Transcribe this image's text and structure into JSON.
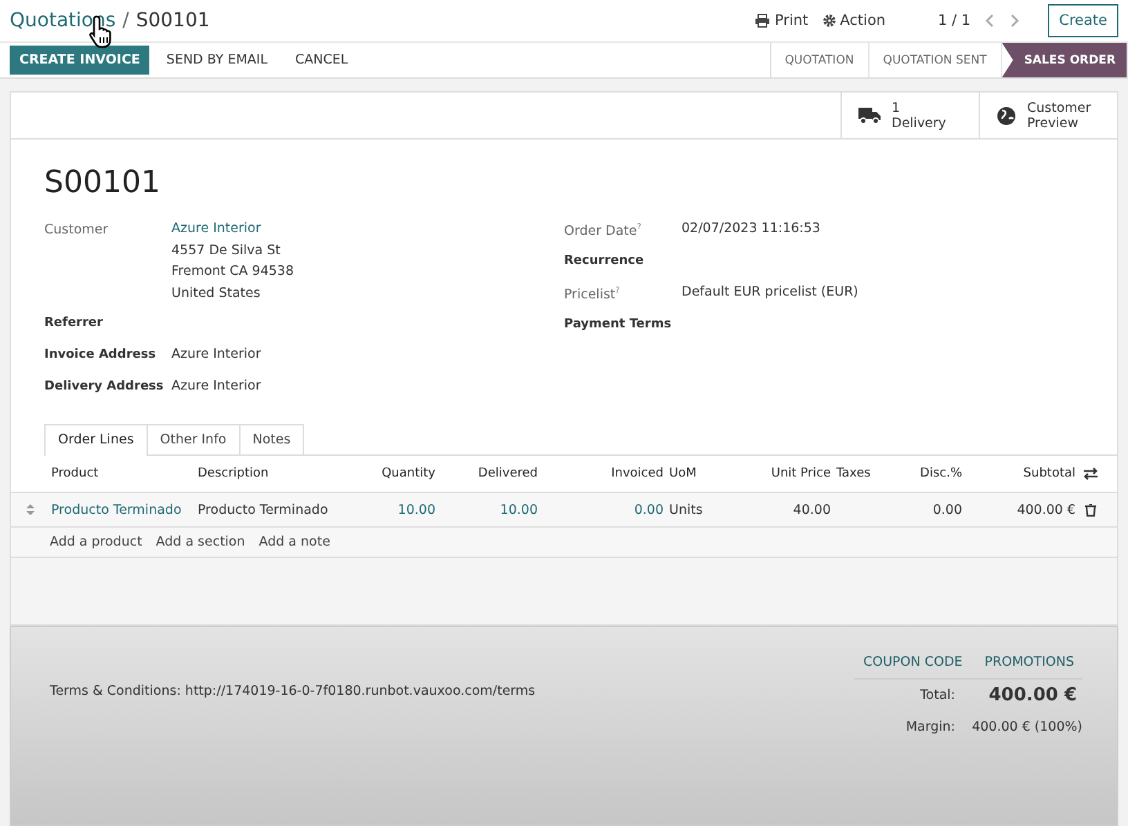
{
  "breadcrumb": {
    "parent": "Quotations",
    "separator": "/",
    "current": "S00101"
  },
  "toolbar": {
    "print": "Print",
    "action": "Action",
    "pager": "1 / 1",
    "create": "Create"
  },
  "actions": [
    {
      "label": "CREATE INVOICE",
      "kind": "primary"
    },
    {
      "label": "SEND BY EMAIL",
      "kind": "link"
    },
    {
      "label": "CANCEL",
      "kind": "link"
    }
  ],
  "status_steps": [
    {
      "label": "QUOTATION",
      "selected": false
    },
    {
      "label": "QUOTATION SENT",
      "selected": false
    },
    {
      "label": "SALES ORDER",
      "selected": true
    }
  ],
  "smart_buttons": [
    {
      "kind": "truck",
      "lines": [
        "1",
        "Delivery"
      ]
    },
    {
      "kind": "globe",
      "lines": [
        "Customer",
        "Preview"
      ]
    }
  ],
  "title": "S00101",
  "left_fields": [
    {
      "label": "Customer",
      "kind": "muted",
      "help": false,
      "link": true,
      "lines": [
        "Azure Interior",
        "4557 De Silva St",
        "Fremont CA 94538",
        "United States"
      ]
    },
    {
      "label": "Referrer",
      "kind": "strong",
      "help": false
    },
    {
      "label": "Invoice Address",
      "kind": "strong",
      "help": false,
      "link": false,
      "lines": [
        "Azure Interior"
      ]
    },
    {
      "label": "Delivery Address",
      "kind": "strong",
      "help": false,
      "link": false,
      "lines": [
        "Azure Interior"
      ]
    }
  ],
  "right_fields": [
    {
      "label": "Order Date",
      "kind": "muted",
      "help": true,
      "link": false,
      "lines": [
        "02/07/2023 11:16:53"
      ]
    },
    {
      "label": "Recurrence",
      "kind": "strong",
      "help": false
    },
    {
      "label": "Pricelist",
      "kind": "muted",
      "help": true,
      "link": false,
      "lines": [
        "Default EUR pricelist (EUR)"
      ]
    },
    {
      "label": "Payment Terms",
      "kind": "strong",
      "help": false
    }
  ],
  "help_mark": "?",
  "tabs": [
    {
      "label": "Order Lines",
      "selected": true
    },
    {
      "label": "Other Info",
      "selected": false
    },
    {
      "label": "Notes",
      "selected": false
    }
  ],
  "table": {
    "columns": [
      "Product",
      "Description",
      "Quantity",
      "Delivered",
      "Invoiced",
      "UoM",
      "Unit Price",
      "Taxes",
      "Disc.%",
      "Subtotal"
    ],
    "rows": [
      {
        "cells": [
          "Producto Terminado",
          "Producto Terminado",
          "10.00",
          "10.00",
          "0.00",
          "Units",
          "40.00",
          "",
          "0.00",
          "400.00 €"
        ]
      }
    ],
    "add_links": [
      "Add a product",
      "Add a section",
      "Add a note"
    ]
  },
  "footer": {
    "terms": "Terms & Conditions: http://174019-16-0-7f0180.runbot.vauxoo.com/terms",
    "buttons": [
      "COUPON CODE",
      "PROMOTIONS"
    ],
    "total_label": "Total:",
    "total": "400.00 €",
    "margin_label": "Margin:",
    "margin": "400.00 € (100%)"
  }
}
